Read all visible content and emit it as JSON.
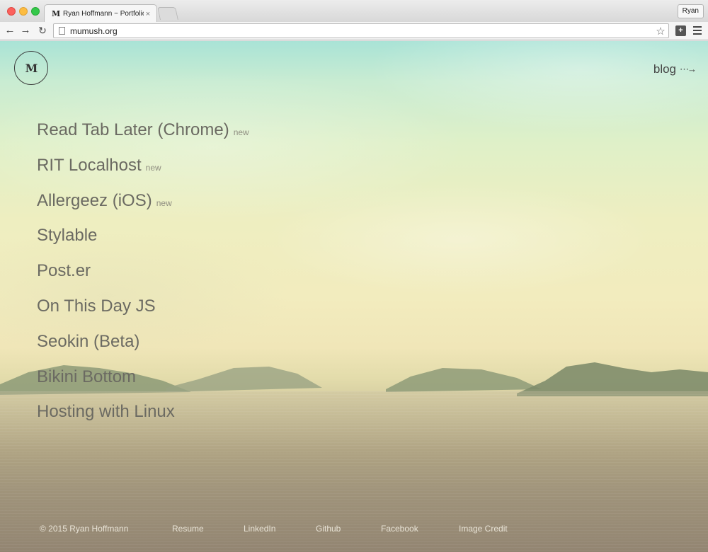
{
  "browser": {
    "tab_title": "Ryan Hoffmann ~ Portfolio",
    "tab_favicon": "M",
    "tab_close": "×",
    "profile_name": "Ryan",
    "url": "mumush.org",
    "icons": {
      "back": "←",
      "forward": "→",
      "reload": "↻",
      "star": "☆",
      "extension": "+"
    }
  },
  "page": {
    "logo": "M",
    "blog_label": "blog",
    "blog_arrow": "⋯→",
    "projects": [
      {
        "name": "Read Tab Later (Chrome)",
        "badge": "new"
      },
      {
        "name": "RIT Localhost",
        "badge": "new"
      },
      {
        "name": "Allergeez (iOS)",
        "badge": "new"
      },
      {
        "name": "Stylable",
        "badge": ""
      },
      {
        "name": "Post.er",
        "badge": ""
      },
      {
        "name": "On This Day JS",
        "badge": ""
      },
      {
        "name": "Seokin (Beta)",
        "badge": ""
      },
      {
        "name": "Bikini Bottom",
        "badge": ""
      },
      {
        "name": "Hosting with Linux",
        "badge": ""
      }
    ],
    "footer": {
      "copyright": "© 2015 Ryan Hoffmann",
      "links": [
        "Resume",
        "LinkedIn",
        "Github",
        "Facebook",
        "Image Credit"
      ]
    }
  }
}
